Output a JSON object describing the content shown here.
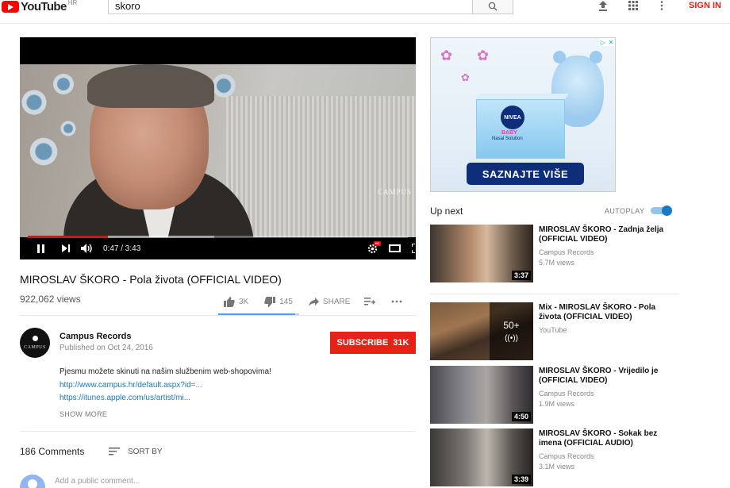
{
  "header": {
    "logo_text": "YouTube",
    "logo_region": "HR",
    "search_value": "skoro",
    "signin_label": "SIGN IN"
  },
  "player": {
    "time": "0:47 / 3:43",
    "watermark": "CAMPUS",
    "progress_fraction": 0.21,
    "buffered_fraction": 0.49
  },
  "video": {
    "title": "MIROSLAV ŠKORO - Pola života (OFFICIAL VIDEO)",
    "views": "922,062 views",
    "likes": "3K",
    "dislikes": "145",
    "share_label": "SHARE",
    "like_ratio": 0.95
  },
  "channel": {
    "name": "Campus Records",
    "published": "Published on Oct 24, 2016",
    "subscribe_label": "SUBSCRIBE",
    "subscriber_count": "31K",
    "avatar_text": "CAMPUS"
  },
  "description": {
    "lines": [
      "Pjesmu možete skinuti na našim službenim web-shopovima!",
      "http://www.campus.hr/default.aspx?id=...",
      "https://itunes.apple.com/us/artist/mi..."
    ],
    "show_more": "SHOW MORE"
  },
  "comments": {
    "count": "186 Comments",
    "sort_label": "SORT BY",
    "placeholder": "Add a public comment..."
  },
  "ad": {
    "brand": "NIVEA",
    "sub": "BABY",
    "product": "Nasal Solution",
    "cta": "SAZNAJTE VIŠE"
  },
  "sidebar": {
    "up_next": "Up next",
    "autoplay_label": "AUTOPLAY",
    "autoplay_on": true,
    "videos": [
      {
        "title": "MIROSLAV ŠKORO - Zadnja želja (OFFICIAL VIDEO)",
        "channel": "Campus Records",
        "views": "5.7M views",
        "duration": "3:37"
      },
      {
        "title": "Mix - MIROSLAV ŠKORO - Pola života (OFFICIAL VIDEO)",
        "channel": "YouTube",
        "views": "",
        "mix_count": "50+"
      },
      {
        "title": "MIROSLAV ŠKORO - Vrijedilo je (OFFICIAL VIDEO)",
        "channel": "Campus Records",
        "views": "1.9M views",
        "duration": "4:50"
      },
      {
        "title": "MIROSLAV ŠKORO - Sokak bez imena (OFFICIAL AUDIO)",
        "channel": "Campus Records",
        "views": "3.1M views",
        "duration": "3:39"
      }
    ]
  },
  "colors": {
    "brand_red": "#e62117",
    "link_blue": "#167ac6",
    "progress_red": "#ff0000"
  },
  "icons": [
    "youtube-logo-icon",
    "search-icon",
    "upload-icon",
    "apps-icon",
    "more-vert-icon",
    "pause-icon",
    "skip-next-icon",
    "volume-icon",
    "settings-icon",
    "theater-icon",
    "fullscreen-icon",
    "thumb-up-icon",
    "thumb-down-icon",
    "share-icon",
    "add-to-playlist-icon",
    "more-horiz-icon",
    "sort-icon",
    "adchoices-icon",
    "close-icon",
    "radio-icon"
  ]
}
